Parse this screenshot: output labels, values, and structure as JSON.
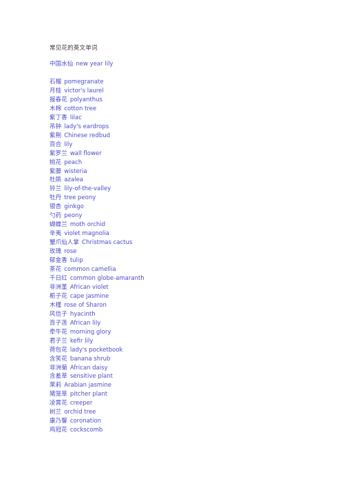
{
  "document": {
    "title": "常见花的英文单词",
    "title_color": "#3b3b3b",
    "entry_color": "#4b4bc8",
    "background_color": "#ffffff",
    "lead_entry": {
      "chinese": "中国水仙",
      "english": "new year lily"
    },
    "entries": [
      {
        "chinese": "石榴",
        "english": "pomegranate"
      },
      {
        "chinese": "月桂",
        "english": "victor's laurel"
      },
      {
        "chinese": "报春花",
        "english": "polyanthus"
      },
      {
        "chinese": "木棉",
        "english": "cotton tree"
      },
      {
        "chinese": "紫丁香",
        "english": "lilac"
      },
      {
        "chinese": "吊钟",
        "english": "lady's eardrops"
      },
      {
        "chinese": "紫荆",
        "english": "Chinese redbud"
      },
      {
        "chinese": "百合",
        "english": "lily"
      },
      {
        "chinese": "紫罗兰",
        "english": "wall flower"
      },
      {
        "chinese": "桃花",
        "english": "peach"
      },
      {
        "chinese": "紫藤",
        "english": "wisteria"
      },
      {
        "chinese": "杜鹃",
        "english": "azalea"
      },
      {
        "chinese": "铃兰",
        "english": "lily-of-the-valley"
      },
      {
        "chinese": "牡丹",
        "english": "tree peony"
      },
      {
        "chinese": "银杏",
        "english": "ginkgo"
      },
      {
        "chinese": "勺药",
        "english": "peony"
      },
      {
        "chinese": "蝴蝶兰",
        "english": "moth orchid"
      },
      {
        "chinese": "辛夷",
        "english": "violet magnolia"
      },
      {
        "chinese": "蟹爪仙人掌",
        "english": "Christmas cactus"
      },
      {
        "chinese": "玫瑰",
        "english": "rose"
      },
      {
        "chinese": "郁金香",
        "english": "tulip"
      },
      {
        "chinese": "茶花",
        "english": "common camellia"
      },
      {
        "chinese": "千日红",
        "english": "common globe-amaranth"
      },
      {
        "chinese": "非洲堇",
        "english": "African violet"
      },
      {
        "chinese": "栀子花",
        "english": "cape jasmine"
      },
      {
        "chinese": "木槿",
        "english": "rose of Sharon"
      },
      {
        "chinese": "风信子",
        "english": "hyacinth"
      },
      {
        "chinese": "百子莲",
        "english": "African lily"
      },
      {
        "chinese": "牵牛花",
        "english": "morning glory"
      },
      {
        "chinese": "君子兰",
        "english": "kefir lily"
      },
      {
        "chinese": "荷包花",
        "english": "lady's pocketbook"
      },
      {
        "chinese": "含笑花",
        "english": "banana shrub"
      },
      {
        "chinese": "非洲菊",
        "english": "African daisy"
      },
      {
        "chinese": "含羞草",
        "english": "sensitive plant"
      },
      {
        "chinese": "茉莉",
        "english": "Arabian jasmine"
      },
      {
        "chinese": "猪笼草",
        "english": "pitcher plant"
      },
      {
        "chinese": "凌霄花",
        "english": "creeper"
      },
      {
        "chinese": "树兰",
        "english": "orchid tree"
      },
      {
        "chinese": "康乃馨",
        "english": "coronation"
      },
      {
        "chinese": "鸡冠花",
        "english": "cockscomb"
      }
    ]
  }
}
